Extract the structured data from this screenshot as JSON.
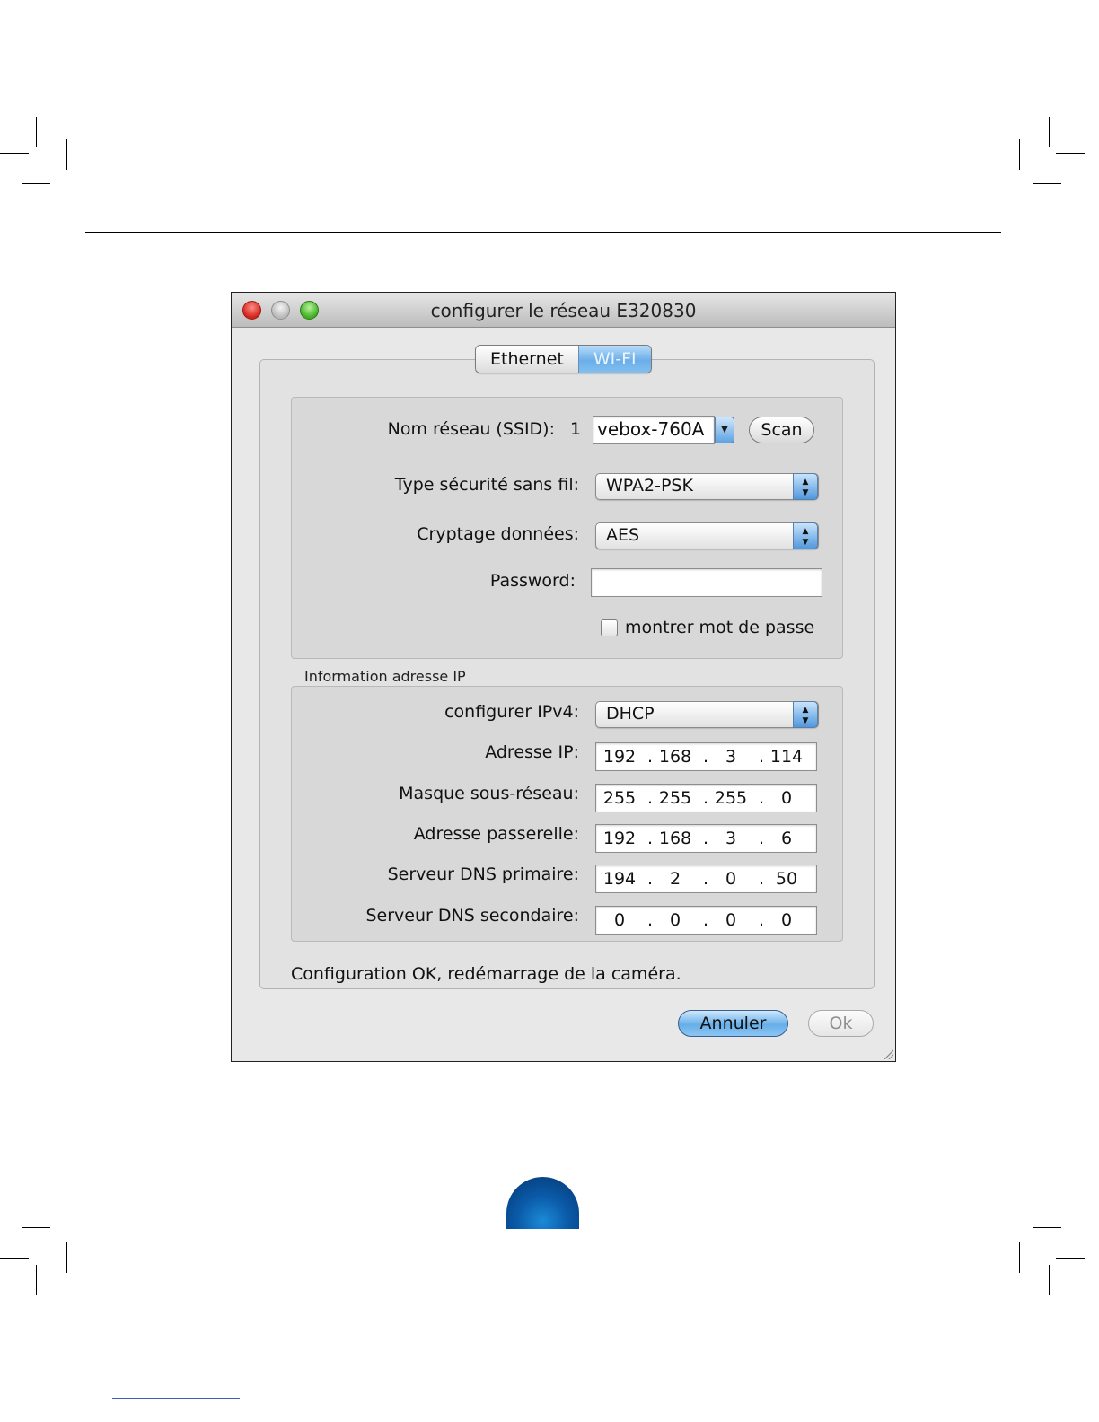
{
  "window": {
    "title": "configurer le réseau E320830"
  },
  "tabs": [
    {
      "label": "Ethernet",
      "selected": false
    },
    {
      "label": "WI-FI",
      "selected": true
    }
  ],
  "wifi": {
    "ssid_label": "Nom réseau (SSID):",
    "ssid_index": "1",
    "ssid_value": "vebox-760A",
    "scan_label": "Scan",
    "security_label": "Type sécurité sans fil:",
    "security_value": "WPA2-PSK",
    "encryption_label": "Cryptage données:",
    "encryption_value": "AES",
    "password_label": "Password:",
    "password_value": "",
    "show_password_label": "montrer mot de passe",
    "show_password_checked": false
  },
  "ip": {
    "section_title": "Information adresse IP",
    "ipv4_label": "configurer IPv4:",
    "ipv4_value": "DHCP",
    "fields": [
      {
        "label": "Adresse IP:",
        "octets": [
          "192",
          "168",
          "3",
          "114"
        ]
      },
      {
        "label": "Masque sous-réseau:",
        "octets": [
          "255",
          "255",
          "255",
          "0"
        ]
      },
      {
        "label": "Adresse passerelle:",
        "octets": [
          "192",
          "168",
          "3",
          "6"
        ]
      },
      {
        "label": "Serveur DNS primaire:",
        "octets": [
          "194",
          "2",
          "0",
          "50"
        ]
      },
      {
        "label": "Serveur DNS secondaire:",
        "octets": [
          "0",
          "0",
          "0",
          "0"
        ]
      }
    ]
  },
  "status_text": "Configuration OK, redémarrage de la caméra.",
  "buttons": {
    "cancel": "Annuler",
    "ok": "Ok"
  },
  "colors": {
    "default_button": "#67aee9",
    "close": "#d2221a",
    "zoom": "#3fae24"
  }
}
